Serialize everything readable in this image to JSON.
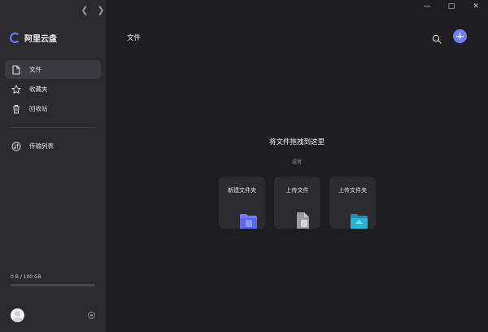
{
  "app": {
    "name": "阿里云盘"
  },
  "sidebar": {
    "items": [
      {
        "label": "文件",
        "icon": "file-icon",
        "active": true
      },
      {
        "label": "收藏夹",
        "icon": "star-icon",
        "active": false
      },
      {
        "label": "回收站",
        "icon": "trash-icon",
        "active": false
      }
    ],
    "transfer": {
      "label": "传输列表",
      "icon": "transfer-icon"
    },
    "storage": {
      "text": "0 B / 100 GB",
      "used_fraction": 0.0
    }
  },
  "header": {
    "title": "文件"
  },
  "drop_zone": {
    "title": "将文件拖拽到这里",
    "or_text": "或者",
    "actions": [
      {
        "label": "新建文件夹",
        "icon": "new-folder-icon",
        "color": "#6f7dff"
      },
      {
        "label": "上传文件",
        "icon": "upload-file-icon",
        "color": "#9b9ba3"
      },
      {
        "label": "上传文件夹",
        "icon": "upload-folder-icon",
        "color": "#2bb3d6"
      }
    ]
  },
  "colors": {
    "accent": "#6f7dff",
    "sidebar_bg": "#2a2a2f",
    "main_bg": "#1e1e22",
    "card_bg": "#2b2b30"
  }
}
